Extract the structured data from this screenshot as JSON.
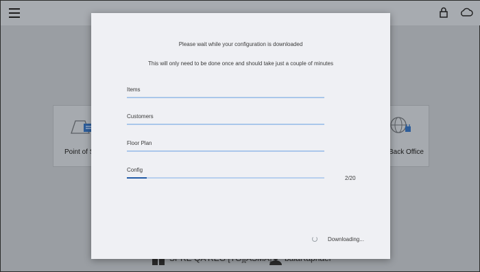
{
  "background": {
    "tiles": {
      "left_label": "Point of Sale",
      "right_label": "Back Office"
    },
    "footer": {
      "store": "SPRE QA REG [TG][ASMA]",
      "user": "balaRaphael"
    },
    "icons": [
      "menu-icon",
      "lock-icon",
      "cloud-icon"
    ]
  },
  "modal": {
    "message_primary": "Please wait while your configuration is downloaded",
    "message_secondary": "This will only need to be done once and should take just a couple of minutes",
    "tasks": [
      {
        "label": "Items",
        "progress": 1.0
      },
      {
        "label": "Customers",
        "progress": 1.0
      },
      {
        "label": "Floor Plan",
        "progress": 1.0
      },
      {
        "label": "Config",
        "progress": 0.1
      }
    ],
    "config_count": "2/20",
    "status": "Downloading..."
  },
  "colors": {
    "modal_bg": "#eff0f4",
    "bar_track": "#b7cfee",
    "bar_active": "#1f5aa6"
  }
}
